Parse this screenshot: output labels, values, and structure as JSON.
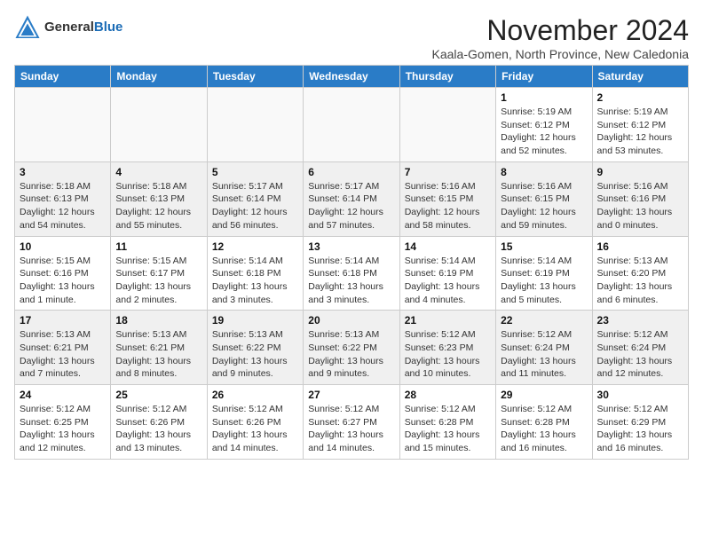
{
  "header": {
    "logo_general": "General",
    "logo_blue": "Blue",
    "month_title": "November 2024",
    "subtitle": "Kaala-Gomen, North Province, New Caledonia"
  },
  "days_of_week": [
    "Sunday",
    "Monday",
    "Tuesday",
    "Wednesday",
    "Thursday",
    "Friday",
    "Saturday"
  ],
  "weeks": [
    {
      "shaded": false,
      "days": [
        {
          "num": "",
          "info": ""
        },
        {
          "num": "",
          "info": ""
        },
        {
          "num": "",
          "info": ""
        },
        {
          "num": "",
          "info": ""
        },
        {
          "num": "",
          "info": ""
        },
        {
          "num": "1",
          "info": "Sunrise: 5:19 AM\nSunset: 6:12 PM\nDaylight: 12 hours\nand 52 minutes."
        },
        {
          "num": "2",
          "info": "Sunrise: 5:19 AM\nSunset: 6:12 PM\nDaylight: 12 hours\nand 53 minutes."
        }
      ]
    },
    {
      "shaded": true,
      "days": [
        {
          "num": "3",
          "info": "Sunrise: 5:18 AM\nSunset: 6:13 PM\nDaylight: 12 hours\nand 54 minutes."
        },
        {
          "num": "4",
          "info": "Sunrise: 5:18 AM\nSunset: 6:13 PM\nDaylight: 12 hours\nand 55 minutes."
        },
        {
          "num": "5",
          "info": "Sunrise: 5:17 AM\nSunset: 6:14 PM\nDaylight: 12 hours\nand 56 minutes."
        },
        {
          "num": "6",
          "info": "Sunrise: 5:17 AM\nSunset: 6:14 PM\nDaylight: 12 hours\nand 57 minutes."
        },
        {
          "num": "7",
          "info": "Sunrise: 5:16 AM\nSunset: 6:15 PM\nDaylight: 12 hours\nand 58 minutes."
        },
        {
          "num": "8",
          "info": "Sunrise: 5:16 AM\nSunset: 6:15 PM\nDaylight: 12 hours\nand 59 minutes."
        },
        {
          "num": "9",
          "info": "Sunrise: 5:16 AM\nSunset: 6:16 PM\nDaylight: 13 hours\nand 0 minutes."
        }
      ]
    },
    {
      "shaded": false,
      "days": [
        {
          "num": "10",
          "info": "Sunrise: 5:15 AM\nSunset: 6:16 PM\nDaylight: 13 hours\nand 1 minute."
        },
        {
          "num": "11",
          "info": "Sunrise: 5:15 AM\nSunset: 6:17 PM\nDaylight: 13 hours\nand 2 minutes."
        },
        {
          "num": "12",
          "info": "Sunrise: 5:14 AM\nSunset: 6:18 PM\nDaylight: 13 hours\nand 3 minutes."
        },
        {
          "num": "13",
          "info": "Sunrise: 5:14 AM\nSunset: 6:18 PM\nDaylight: 13 hours\nand 3 minutes."
        },
        {
          "num": "14",
          "info": "Sunrise: 5:14 AM\nSunset: 6:19 PM\nDaylight: 13 hours\nand 4 minutes."
        },
        {
          "num": "15",
          "info": "Sunrise: 5:14 AM\nSunset: 6:19 PM\nDaylight: 13 hours\nand 5 minutes."
        },
        {
          "num": "16",
          "info": "Sunrise: 5:13 AM\nSunset: 6:20 PM\nDaylight: 13 hours\nand 6 minutes."
        }
      ]
    },
    {
      "shaded": true,
      "days": [
        {
          "num": "17",
          "info": "Sunrise: 5:13 AM\nSunset: 6:21 PM\nDaylight: 13 hours\nand 7 minutes."
        },
        {
          "num": "18",
          "info": "Sunrise: 5:13 AM\nSunset: 6:21 PM\nDaylight: 13 hours\nand 8 minutes."
        },
        {
          "num": "19",
          "info": "Sunrise: 5:13 AM\nSunset: 6:22 PM\nDaylight: 13 hours\nand 9 minutes."
        },
        {
          "num": "20",
          "info": "Sunrise: 5:13 AM\nSunset: 6:22 PM\nDaylight: 13 hours\nand 9 minutes."
        },
        {
          "num": "21",
          "info": "Sunrise: 5:12 AM\nSunset: 6:23 PM\nDaylight: 13 hours\nand 10 minutes."
        },
        {
          "num": "22",
          "info": "Sunrise: 5:12 AM\nSunset: 6:24 PM\nDaylight: 13 hours\nand 11 minutes."
        },
        {
          "num": "23",
          "info": "Sunrise: 5:12 AM\nSunset: 6:24 PM\nDaylight: 13 hours\nand 12 minutes."
        }
      ]
    },
    {
      "shaded": false,
      "days": [
        {
          "num": "24",
          "info": "Sunrise: 5:12 AM\nSunset: 6:25 PM\nDaylight: 13 hours\nand 12 minutes."
        },
        {
          "num": "25",
          "info": "Sunrise: 5:12 AM\nSunset: 6:26 PM\nDaylight: 13 hours\nand 13 minutes."
        },
        {
          "num": "26",
          "info": "Sunrise: 5:12 AM\nSunset: 6:26 PM\nDaylight: 13 hours\nand 14 minutes."
        },
        {
          "num": "27",
          "info": "Sunrise: 5:12 AM\nSunset: 6:27 PM\nDaylight: 13 hours\nand 14 minutes."
        },
        {
          "num": "28",
          "info": "Sunrise: 5:12 AM\nSunset: 6:28 PM\nDaylight: 13 hours\nand 15 minutes."
        },
        {
          "num": "29",
          "info": "Sunrise: 5:12 AM\nSunset: 6:28 PM\nDaylight: 13 hours\nand 16 minutes."
        },
        {
          "num": "30",
          "info": "Sunrise: 5:12 AM\nSunset: 6:29 PM\nDaylight: 13 hours\nand 16 minutes."
        }
      ]
    }
  ]
}
